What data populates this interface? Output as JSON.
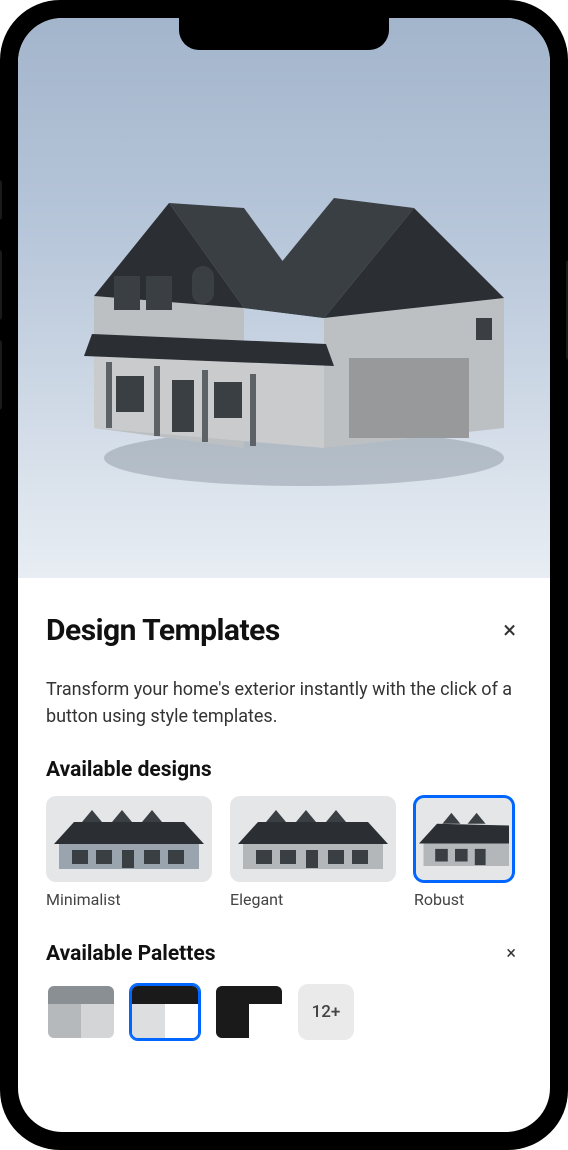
{
  "sheet": {
    "title": "Design Templates",
    "description": "Transform your home's exterior instantly with the click of a button using style templates.",
    "close_icon": "×"
  },
  "sections": {
    "designs": {
      "title": "Available designs",
      "items": [
        {
          "label": "Minimalist",
          "selected": false
        },
        {
          "label": "Elegant",
          "selected": false
        },
        {
          "label": "Robust",
          "selected": true
        }
      ]
    },
    "palettes": {
      "title": "Available Palettes",
      "close_icon": "×",
      "more_label": "12+",
      "items": [
        {
          "top": "#8a8f94",
          "bl": "#b6b9bc",
          "br": "#d3d5d7",
          "selected": false
        },
        {
          "top": "#1a1a1a",
          "bl": "#dcdedf",
          "br": "#ffffff",
          "selected": true
        },
        {
          "top": "#1a1a1a",
          "bl": "#1a1a1a",
          "br": "#ffffff",
          "selected": false
        }
      ]
    }
  }
}
